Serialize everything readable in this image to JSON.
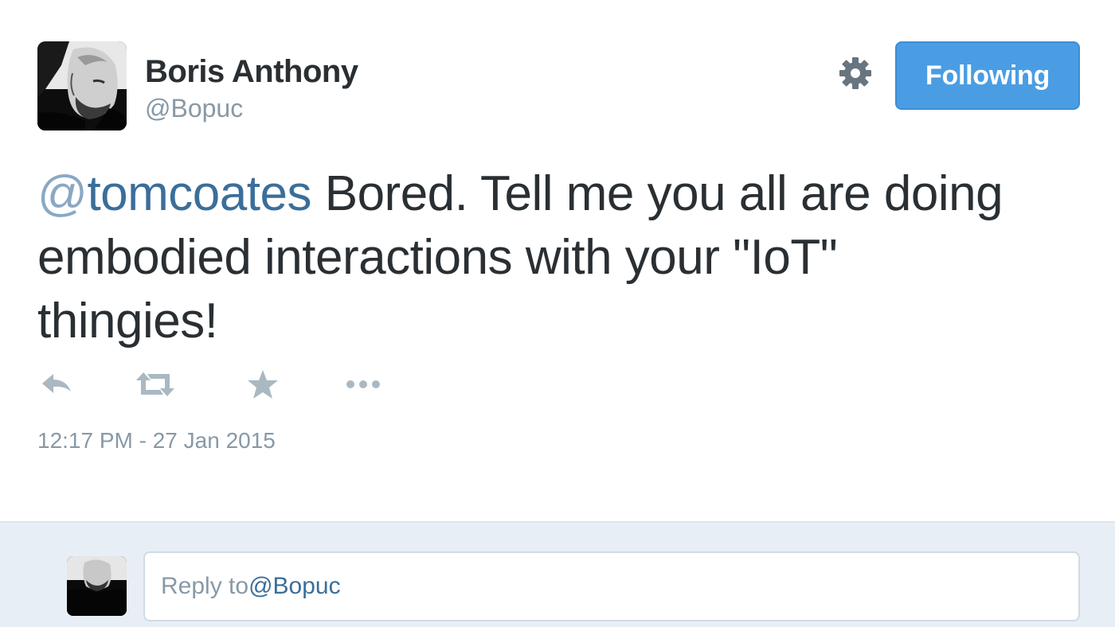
{
  "tweet": {
    "author": {
      "name": "Boris Anthony",
      "handle": "@Bopuc"
    },
    "follow_button_label": "Following",
    "mention": "@tomcoates",
    "mention_at": "@",
    "mention_name": "tomcoates",
    "text_line1": " Bored. Tell me you all are doing",
    "text_line2": "embodied interactions with your \"IoT\"",
    "text_line3": "thingies!",
    "timestamp": "12:17 PM - 27 Jan 2015",
    "actions": [
      {
        "name": "reply",
        "icon": "reply-icon"
      },
      {
        "name": "retweet",
        "icon": "retweet-icon"
      },
      {
        "name": "favorite",
        "icon": "star-icon"
      },
      {
        "name": "more",
        "icon": "more-icon"
      }
    ]
  },
  "reply": {
    "prefix": "Reply to ",
    "handle": "@Bopuc"
  },
  "colors": {
    "accent": "#4a9de3",
    "link": "#3b6e9a",
    "muted": "#8899a6",
    "text": "#292f33",
    "reply_bg": "#e8eef5"
  }
}
